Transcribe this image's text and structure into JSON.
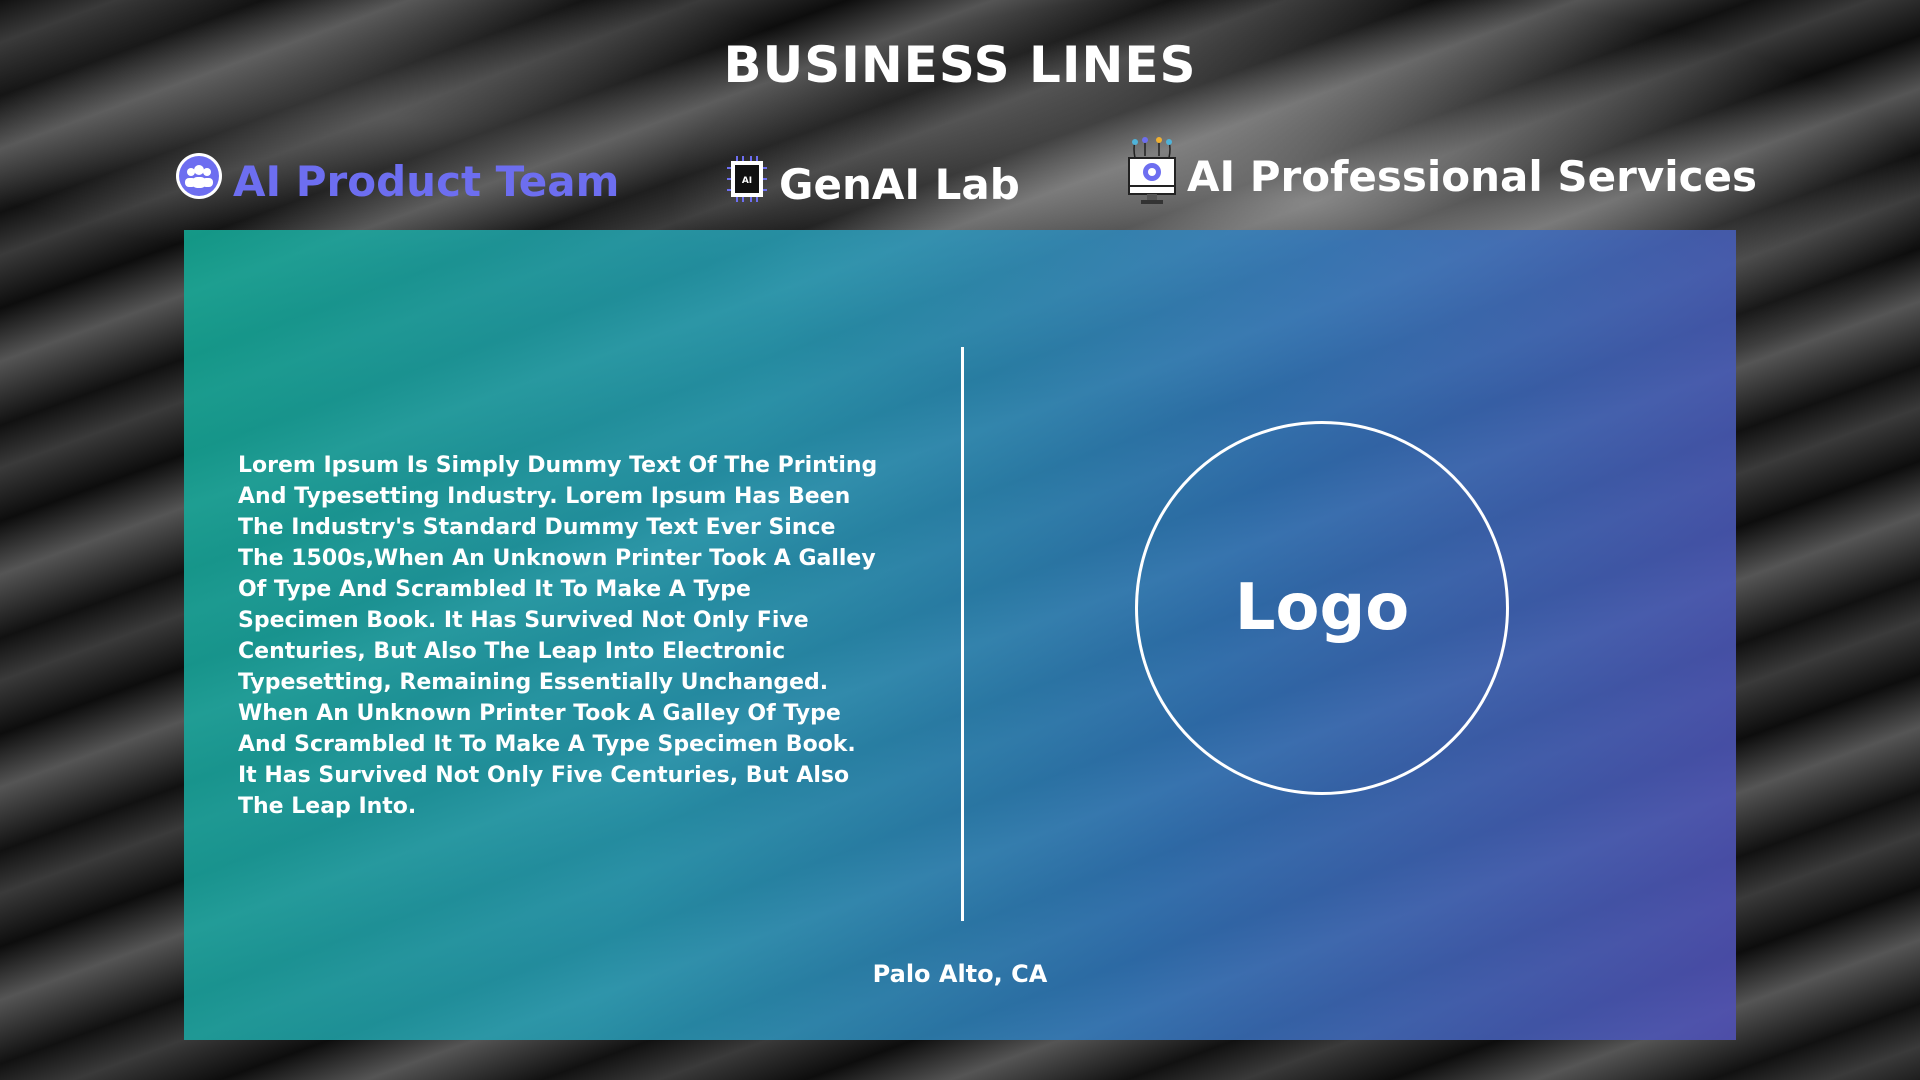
{
  "header": {
    "title": "BUSINESS LINES"
  },
  "tabs": [
    {
      "label": "AI Product Team",
      "icon": "team-icon",
      "active": true
    },
    {
      "label": "GenAI Lab",
      "icon": "ai-chip-icon",
      "active": false
    },
    {
      "label": "AI Professional Services",
      "icon": "monitor-gear-icon",
      "active": false
    }
  ],
  "colors": {
    "active_tab": "#6d6ef0"
  },
  "panel": {
    "description": "Lorem Ipsum Is Simply Dummy Text Of The Printing And Typesetting Industry. Lorem Ipsum Has Been The Industry's Standard Dummy Text Ever Since The 1500s,When An Unknown Printer Took A Galley Of Type And Scrambled It To Make A Type Specimen Book. It Has Survived Not Only Five Centuries, But Also The Leap Into Electronic Typesetting, Remaining Essentially Unchanged. When An Unknown Printer Took A Galley Of Type And Scrambled It To Make A Type Specimen Book. It Has Survived Not Only Five Centuries, But Also The Leap Into.",
    "logo_label": "Logo",
    "location": "Palo Alto, CA"
  }
}
